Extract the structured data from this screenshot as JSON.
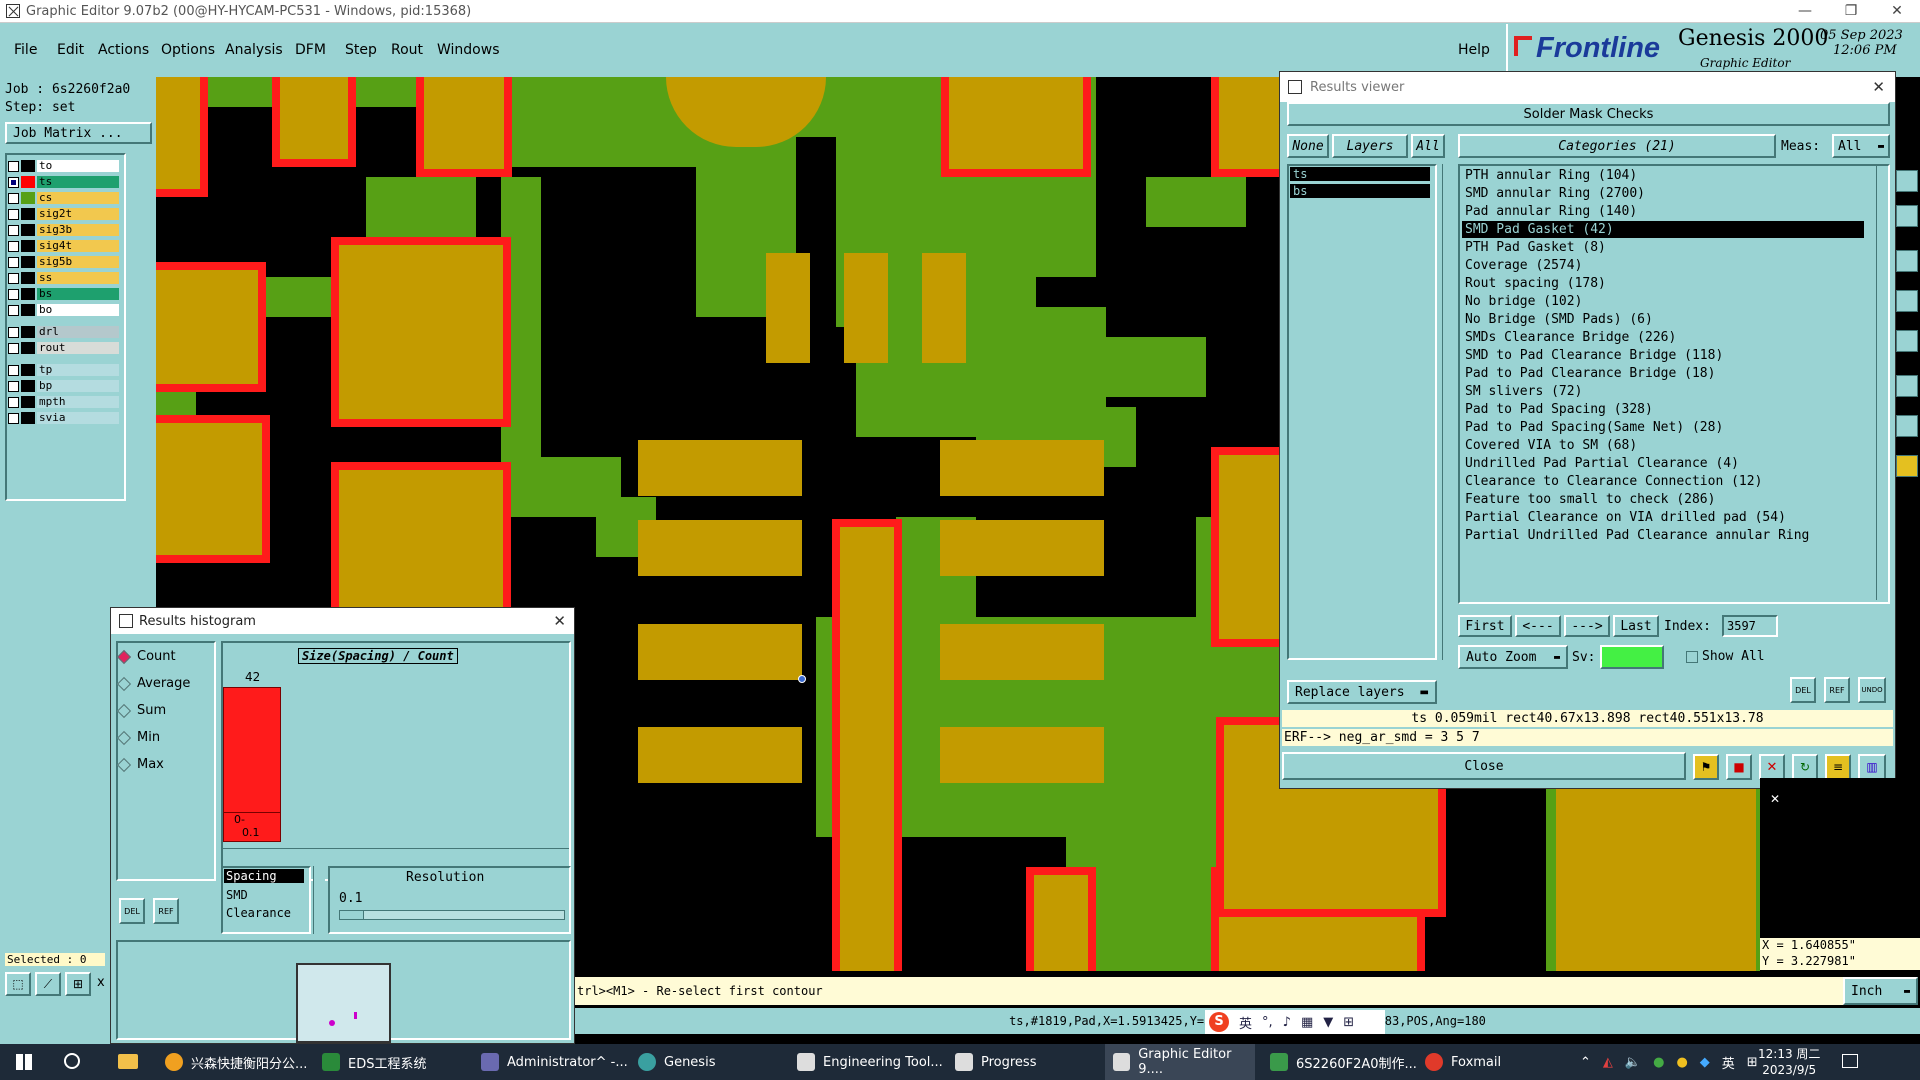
{
  "window": {
    "title": "Graphic Editor 9.07b2 (00@HY-HYCAM-PC531 - Windows, pid:15368)"
  },
  "menu": [
    "File",
    "Edit",
    "Actions",
    "Options",
    "Analysis",
    "DFM",
    "Step",
    "Rout",
    "Windows"
  ],
  "menu_help": "Help",
  "brand": {
    "logo": "Frontline",
    "product": "Genesis 2000",
    "subtitle": "Graphic Editor",
    "date": "05 Sep 2023",
    "time": "12:06 PM"
  },
  "job": {
    "job_label": "Job : 6s2260f2a0",
    "step_label": "Step: set",
    "matrix_button": "Job Matrix ..."
  },
  "layers": [
    {
      "name": "to",
      "color": "#ffffff",
      "swatch": "#000000",
      "checked": false
    },
    {
      "name": "ts",
      "color": "#1ea06e",
      "swatch": "#ff0000",
      "checked": true
    },
    {
      "name": "cs",
      "color": "#f2c84e",
      "swatch": "#57a015",
      "checked": false
    },
    {
      "name": "sig2t",
      "color": "#f2c84e",
      "swatch": "#000000",
      "checked": false
    },
    {
      "name": "sig3b",
      "color": "#f2c84e",
      "swatch": "#000000",
      "checked": false
    },
    {
      "name": "sig4t",
      "color": "#f2c84e",
      "swatch": "#000000",
      "checked": false
    },
    {
      "name": "sig5b",
      "color": "#f2c84e",
      "swatch": "#000000",
      "checked": false
    },
    {
      "name": "ss",
      "color": "#f2c84e",
      "swatch": "#000000",
      "checked": false
    },
    {
      "name": "bs",
      "color": "#1ea06e",
      "swatch": "#000000",
      "checked": false
    },
    {
      "name": "bo",
      "color": "#ffffff",
      "swatch": "#000000",
      "checked": false
    },
    {
      "name": "drl",
      "color": "#b4c8cc",
      "swatch": "#000000",
      "checked": false
    },
    {
      "name": "rout",
      "color": "#d8dcd8",
      "swatch": "#000000",
      "checked": false
    },
    {
      "name": "tp",
      "color": "#b4dce0",
      "swatch": "#000000",
      "checked": false
    },
    {
      "name": "bp",
      "color": "#b4dce0",
      "swatch": "#000000",
      "checked": false
    },
    {
      "name": "mpth",
      "color": "#b4dce0",
      "swatch": "#000000",
      "checked": false
    },
    {
      "name": "svia",
      "color": "#b4dce0",
      "swatch": "#000000",
      "checked": false
    }
  ],
  "selected_label": "Selected : 0",
  "results_viewer": {
    "title": "Results viewer",
    "heading": "Solder Mask Checks",
    "btn_none": "None",
    "btn_layers": "Layers",
    "btn_all": "All",
    "categories_label": "Categories (21)",
    "meas_label": "Meas:",
    "meas_value": "All",
    "layer_list": [
      "ts",
      "bs"
    ],
    "categories": [
      "PTH annular Ring (104)",
      "SMD annular Ring (2700)",
      "Pad annular Ring (140)",
      "SMD Pad Gasket (42)",
      "PTH Pad Gasket (8)",
      "Coverage (2574)",
      "Rout spacing (178)",
      "No bridge (102)",
      "No Bridge (SMD Pads) (6)",
      "SMDs Clearance Bridge (226)",
      "SMD to Pad Clearance Bridge (118)",
      "Pad to Pad Clearance Bridge (18)",
      "SM slivers (72)",
      "Pad to Pad Spacing (328)",
      "Pad to Pad Spacing(Same Net) (28)",
      "Covered VIA to SM (68)",
      "Undrilled Pad Partial Clearance (4)",
      "Clearance to Clearance Connection (12)",
      "Feature too small to check (286)",
      "Partial Clearance on VIA drilled pad (54)",
      "Partial Undrilled Pad Clearance annular Ring"
    ],
    "selected_index": 3,
    "nav_first": "First",
    "nav_prev": "<---",
    "nav_next": "--->",
    "nav_last": "Last",
    "index_label": "Index:",
    "index_value": "3597",
    "auto_zoom": "Auto Zoom",
    "sv_label": "Sv:",
    "show_all": "Show All",
    "replace_layers": "Replace layers",
    "info_line": "ts 0.059mil  rect40.67x13.898  rect40.551x13.78",
    "erf_line": "ERF--> neg_ar_smd = 3 5 7",
    "close": "Close",
    "del_label": "DEL",
    "ref_label": "REF",
    "undo_label": "UNDO"
  },
  "histogram": {
    "title": "Results histogram",
    "modes": [
      "Count",
      "Average",
      "Sum",
      "Min",
      "Max"
    ],
    "selected_mode": 0,
    "chart_title": "Size(Spacing) / Count",
    "bar_value": "42",
    "bar_label_top": "0-",
    "bar_label_bottom": "0.1",
    "list": [
      "Spacing",
      "SMD",
      "Clearance"
    ],
    "resolution_label": "Resolution",
    "resolution_value": "0.1",
    "del_label": "DEL",
    "ref_label": "REF"
  },
  "status": {
    "hint": "trl><M1> - Re-select first contour",
    "feature": "ts,#1819,Pad,X=1.5913425,Y=3.2702913,rect45.689x39.783,POS,Ang=180",
    "x": "X = 1.640855\"",
    "y": "Y = 3.227981\"",
    "unit": "Inch"
  },
  "taskbar": {
    "items": [
      "兴森快捷衡阳分公...",
      "EDS工程系统",
      "Administrator^ -...",
      "Genesis",
      "Engineering Tool...",
      "Progress",
      "Graphic Editor 9....",
      "6S2260F2A0制作...",
      "Foxmail"
    ],
    "ime": "英",
    "time": "12:13 周二",
    "date": "2023/9/5"
  },
  "colors": {
    "panel": "#9ad3d3",
    "copper": "#57a015",
    "pad": "#c39b00",
    "mask": "#ff1b1b"
  }
}
